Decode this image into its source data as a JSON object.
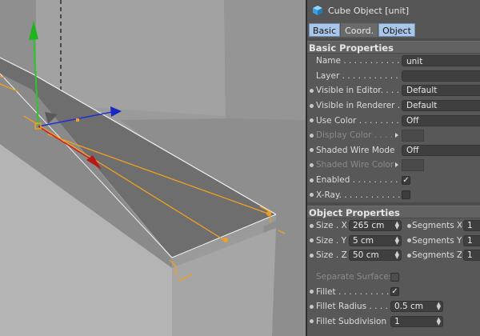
{
  "panel": {
    "title": "Cube Object [unit]",
    "tabs": [
      "Basic",
      "Coord.",
      "Object"
    ]
  },
  "basic": {
    "header": "Basic Properties",
    "name_label": "Name . . . . . . . . . . . .",
    "name_value": "unit",
    "layer_label": "Layer . . . . . . . . . . .",
    "vis_editor_label": "Visible in Editor. . . . .",
    "vis_editor_value": "Default",
    "vis_renderer_label": "Visible in Renderer . .",
    "vis_renderer_value": "Default",
    "use_color_label": "Use Color . . . . . . . . .",
    "use_color_value": "Off",
    "display_color_label": "Display Color . . . .",
    "shaded_wire_mode_label": "Shaded Wire Mode",
    "shaded_wire_mode_value": "Off",
    "shaded_wire_color_label": "Shaded Wire Color",
    "enabled_label": "Enabled . . . . . . . . . .",
    "enabled_check": "✓",
    "xray_label": "X-Ray. . . . . . . . . . . ."
  },
  "object": {
    "header": "Object Properties",
    "size_x_label": "Size . X",
    "size_x_value": "265 cm",
    "size_y_label": "Size . Y",
    "size_y_value": "5 cm",
    "size_z_label": "Size . Z",
    "size_z_value": "50 cm",
    "seg_x_label": "Segments X",
    "seg_x_value": "1",
    "seg_y_label": "Segments Y",
    "seg_y_value": "1",
    "seg_z_label": "Segments Z",
    "seg_z_value": "1",
    "separate_label": "Separate Surfaces",
    "fillet_label": "Fillet . . . . . . . . . . . .",
    "fillet_check": "✓",
    "fillet_radius_label": "Fillet Radius . . . . .",
    "fillet_radius_value": "0.5 cm",
    "fillet_subdiv_label": "Fillet Subdivision",
    "fillet_subdiv_value": "1"
  },
  "colors": {
    "selection": "#f0a020",
    "axis_x": "#cc2020",
    "axis_y": "#28c828",
    "axis_z": "#2030d0",
    "tab_active": "#a9c6e9"
  }
}
